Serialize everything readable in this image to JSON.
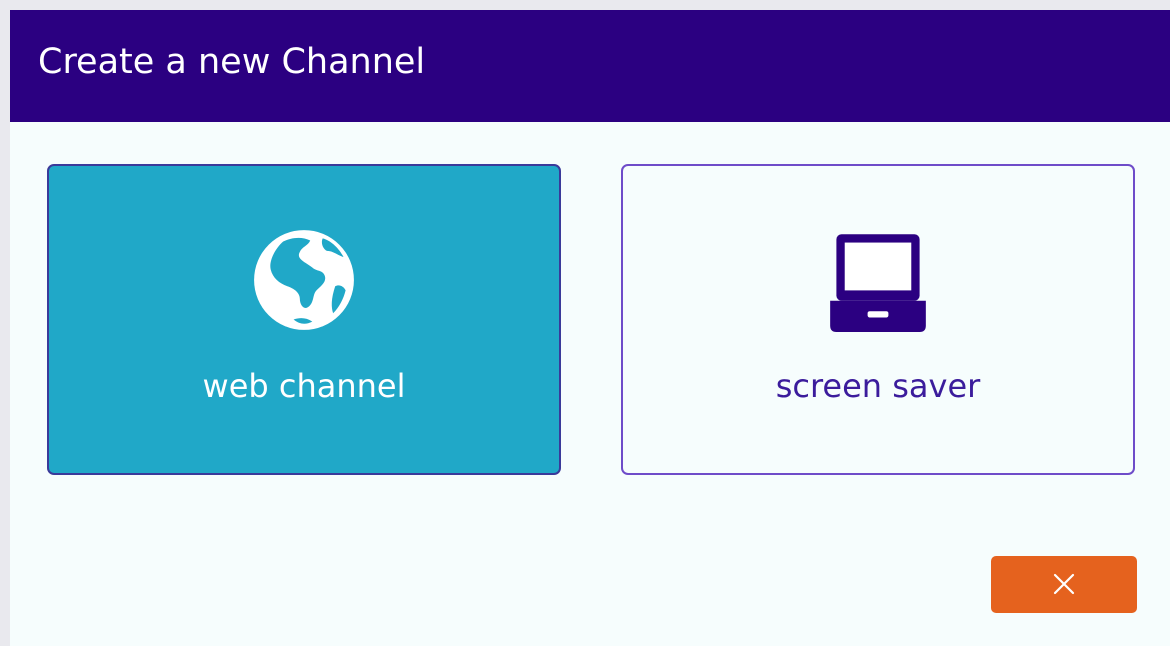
{
  "dialog": {
    "title": "Create a new Channel"
  },
  "options": [
    {
      "label": "web channel",
      "icon": "globe-icon",
      "selected": true
    },
    {
      "label": "screen saver",
      "icon": "laptop-icon",
      "selected": false
    }
  ],
  "close_button": {
    "icon": "close-icon"
  },
  "colors": {
    "header": "#2b0081",
    "selected_card": "#20a8c8",
    "card_border": "#6e4cc9",
    "accent_text": "#3b1c9c",
    "close_button": "#e5621e",
    "dialog_background": "#f6fdfd"
  }
}
